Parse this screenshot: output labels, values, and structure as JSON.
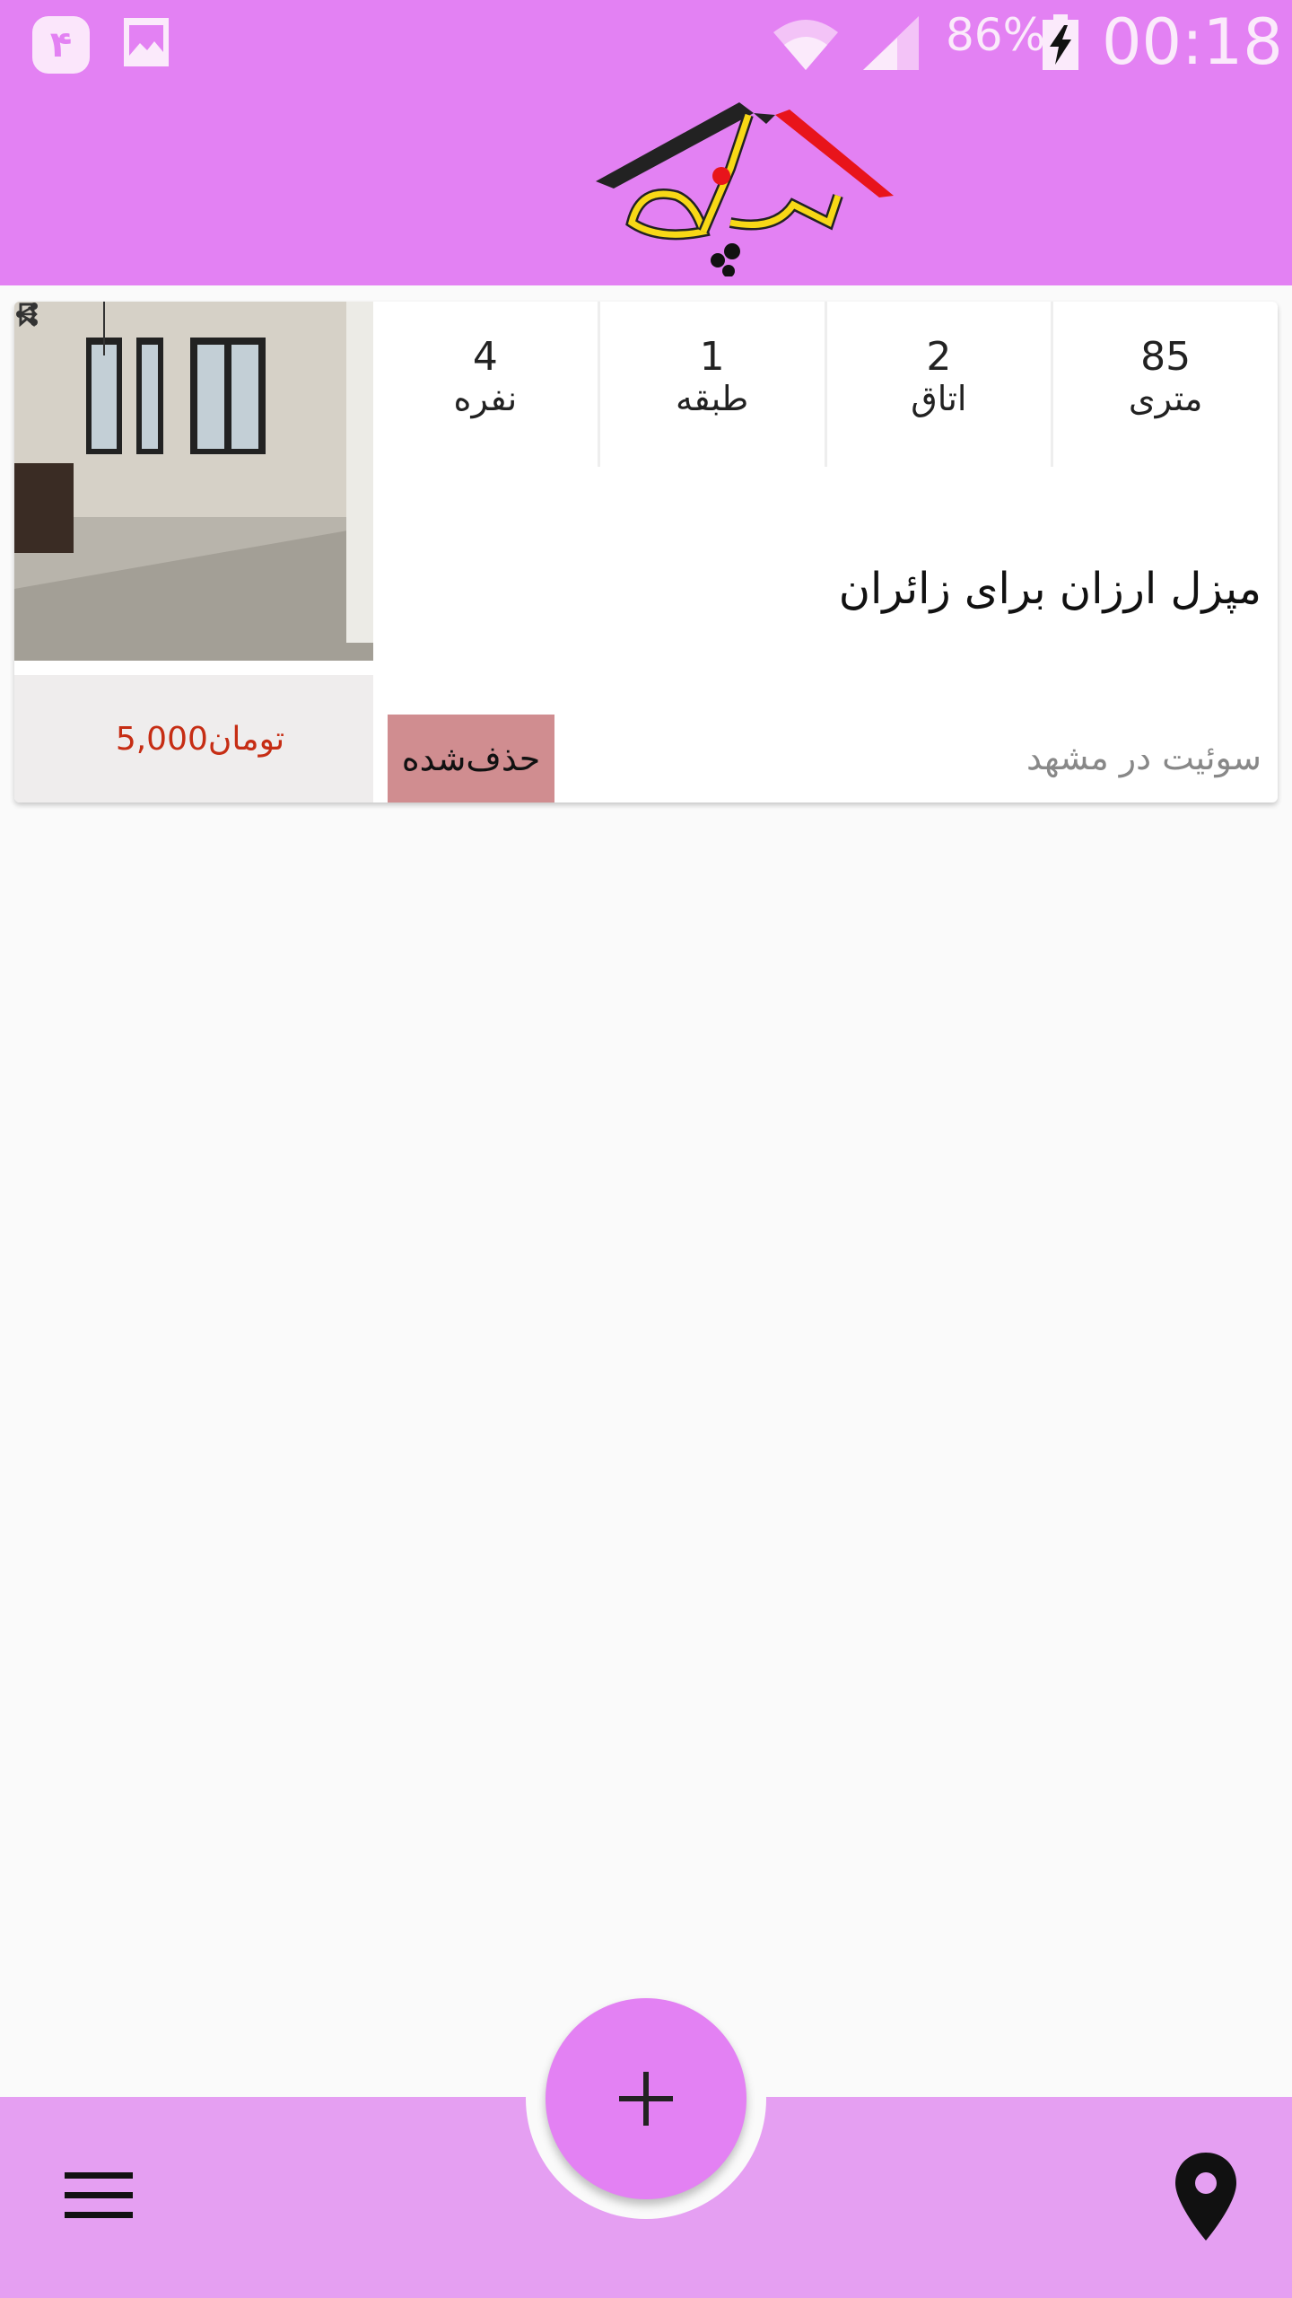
{
  "status_bar": {
    "notification_badge": "۴",
    "battery_percent": "86%",
    "time": "00:18",
    "icons": [
      "gallery-icon",
      "wifi-icon",
      "signal-icon",
      "battery-charging-icon"
    ]
  },
  "header": {
    "logo_alt": "مپزل",
    "background": "#e381f3"
  },
  "listing": {
    "specs": [
      {
        "value": "4",
        "label": "نفره"
      },
      {
        "value": "1",
        "label": "طبقه"
      },
      {
        "value": "2",
        "label": "اتاق"
      },
      {
        "value": "85",
        "label": "متری"
      }
    ],
    "title": "مپزل ارزان برای زائران",
    "subtitle": "سوئیت در مشهد",
    "status_badge": "حذف‌شده",
    "price_value": "5,000",
    "price_unit": "تومان",
    "photo_icons": [
      "share-icon",
      "bookmark-icon",
      "arrow-right-icon"
    ]
  },
  "bottom_bar": {
    "fab_icon": "plus-icon",
    "left_icon": "menu-icon",
    "right_icon": "location-pin-icon",
    "background": "#e59ff2"
  }
}
